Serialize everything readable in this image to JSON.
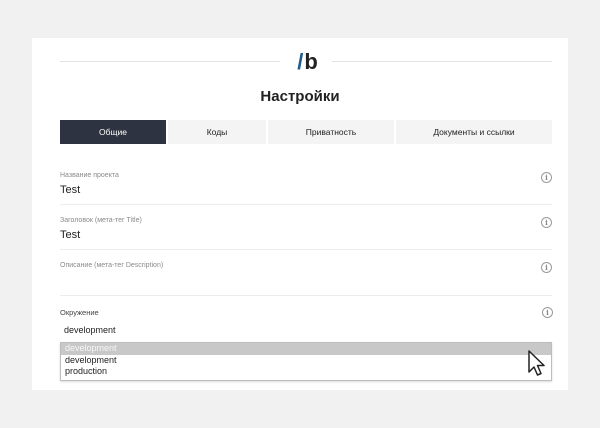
{
  "logo": {
    "slash": "/",
    "letter": "b"
  },
  "page_title": "Настройки",
  "tabs": [
    {
      "label": "Общие",
      "active": true
    },
    {
      "label": "Коды",
      "active": false
    },
    {
      "label": "Приватность",
      "active": false
    },
    {
      "label": "Документы и ссылки",
      "active": false
    }
  ],
  "fields": [
    {
      "label": "Название проекта",
      "value": "Test"
    },
    {
      "label": "Заголовок (мета-тег Title)",
      "value": "Test"
    },
    {
      "label": "Описание (мета-тег Description)",
      "value": ""
    }
  ],
  "environment": {
    "label": "Окружение",
    "value": "development",
    "options": [
      "development",
      "development",
      "production"
    ],
    "highlighted_index": 0
  },
  "icons": {
    "info": "info-icon",
    "cursor": "mouse-pointer-icon"
  },
  "colors": {
    "tab_active_bg": "#2d3340",
    "logo_slash": "#1f5c8b"
  }
}
